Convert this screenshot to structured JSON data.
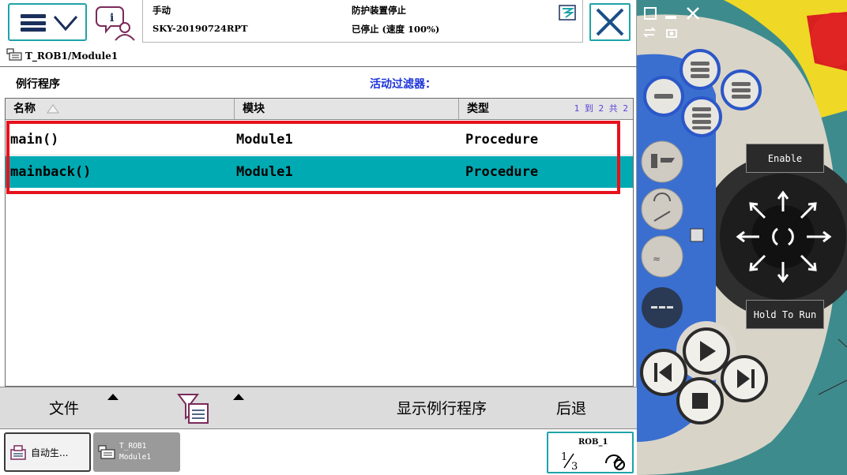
{
  "header": {
    "operating_mode": "手动",
    "system_name": "SKY-20190724RPT",
    "safety_status": "防护装置停止",
    "motor_status": "已停止 (速度 100%)"
  },
  "path": "T_ROB1/Module1",
  "view": {
    "title": "例行程序",
    "filter_label": "活动过滤器："
  },
  "table": {
    "columns": [
      "名称",
      "模块",
      "类型"
    ],
    "count_text": "1 到 2 共 2",
    "rows": [
      {
        "name": "main()",
        "module": "Module1",
        "type": "Procedure",
        "selected": false
      },
      {
        "name": "mainback()",
        "module": "Module1",
        "type": "Procedure",
        "selected": true
      }
    ]
  },
  "commands": {
    "file": "文件",
    "show_routine": "显示例行程序",
    "back": "后退"
  },
  "taskbar": {
    "items": [
      {
        "label": "自动生..."
      },
      {
        "line1": "T_ROB1",
        "line2": "Module1"
      }
    ],
    "quickset_label": "ROB_1"
  },
  "hardware": {
    "enable_label": "Enable",
    "hold_to_run_label": "Hold To Run"
  },
  "colors": {
    "accent": "#1fa3a8",
    "selected_row": "#00aab2",
    "highlight_box": "#e5121d",
    "filter_label": "#1c33d9",
    "hardware_blue": "#3a6fd0",
    "hardware_gray": "#d9d4c8"
  },
  "icons": {
    "menu": "hamburger-menu-icon",
    "info": "event-log-icon",
    "close": "close-icon",
    "path": "program-editor-icon",
    "sort": "sort-ascending-icon",
    "filter": "filter-icon",
    "quickset": "quickset-icon"
  }
}
